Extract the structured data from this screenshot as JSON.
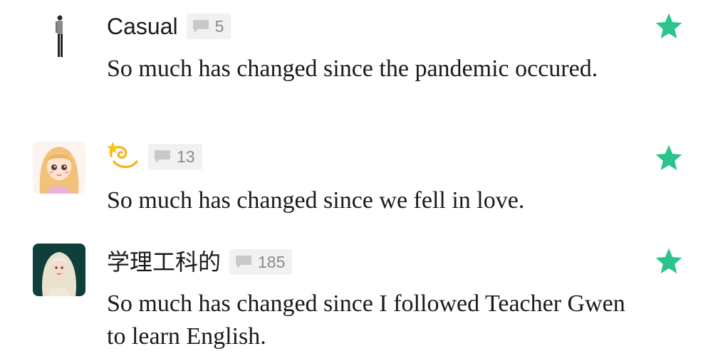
{
  "colors": {
    "star": "#2bc48a",
    "badge_bg": "#f1f1f1",
    "badge_text": "#8a8a8a",
    "text": "#1a1a1a"
  },
  "comments": [
    {
      "username": "Casual",
      "avatar_icon": "standing-person-icon",
      "count": "5",
      "text": "So much has changed since the pandemic occured.",
      "starred": true
    },
    {
      "username": "💫",
      "avatar_icon": "cartoon-girl-avatar",
      "count": "13",
      "text": "So much has changed since we fell in love.",
      "starred": true
    },
    {
      "username": "学理工科的",
      "avatar_icon": "blonde-woman-photo-avatar",
      "count": "185",
      "text": "So much has changed since I followed Teacher Gwen to learn English.",
      "starred": true
    }
  ]
}
